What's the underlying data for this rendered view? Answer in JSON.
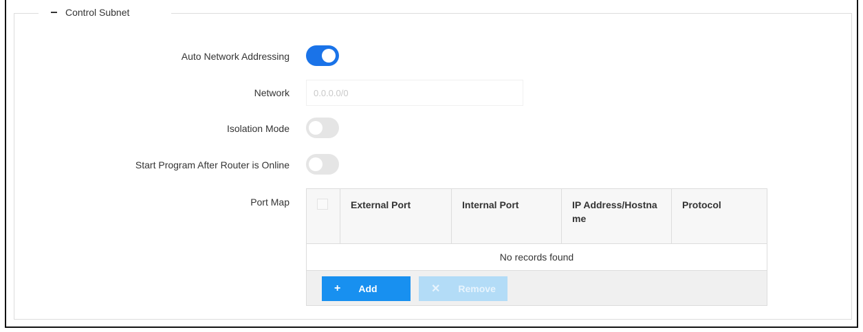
{
  "section": {
    "title": "Control Subnet",
    "collapse_icon": "minus-icon"
  },
  "fields": {
    "auto_network": {
      "label": "Auto Network Addressing",
      "value": "on"
    },
    "network": {
      "label": "Network",
      "placeholder": "0.0.0.0/0"
    },
    "isolation": {
      "label": "Isolation Mode",
      "value": "off"
    },
    "start_program": {
      "label": "Start Program After Router is Online",
      "value": "off"
    },
    "port_map": {
      "label": "Port Map"
    }
  },
  "port_map_table": {
    "columns": [
      "External Port",
      "Internal Port",
      "IP Address/Hostname",
      "Protocol"
    ],
    "column_display": [
      "External Port",
      "Internal Port",
      "IP Address/Hostna me",
      "Protocol"
    ],
    "empty_text": "No records found",
    "add_label": "Add",
    "add_icon": "plus-icon",
    "remove_label": "Remove",
    "remove_icon": "x-icon"
  },
  "colors": {
    "toggle_on": "#1a73e8",
    "toggle_off": "#e5e5e5",
    "add_button": "#1890f0",
    "remove_button_disabled": "#b3dcf7"
  }
}
